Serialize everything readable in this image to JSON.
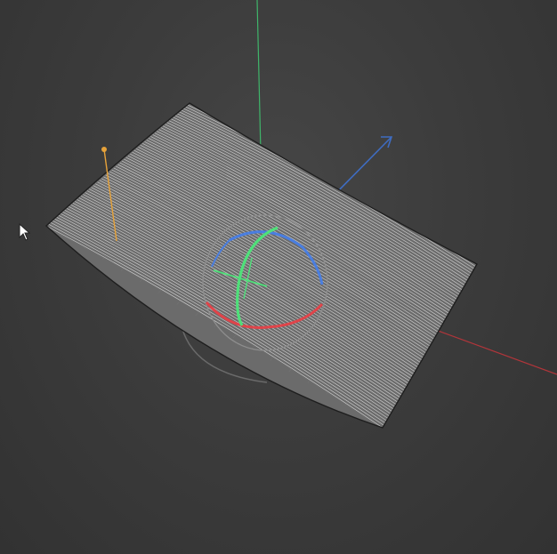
{
  "viewport": {
    "background_color": "#3c3c3c"
  },
  "axes": {
    "x_color": "#b0353a",
    "y_color": "#3fb56a",
    "z_color": "#3f6cc0"
  },
  "plane": {
    "fill_color": "#6b6b6b",
    "wire_color": "#d8d8d8",
    "edge_color": "#1e1e1e"
  },
  "gizmo": {
    "type": "rotate",
    "ring_x_color": "#e0444a",
    "ring_y_color": "#4fe07a",
    "ring_z_color": "#4a7ee0",
    "outline_color": "#9a9a9a"
  },
  "light_handle": {
    "color": "#e6a23a"
  },
  "cursor_icon": "mouse-pointer-icon"
}
